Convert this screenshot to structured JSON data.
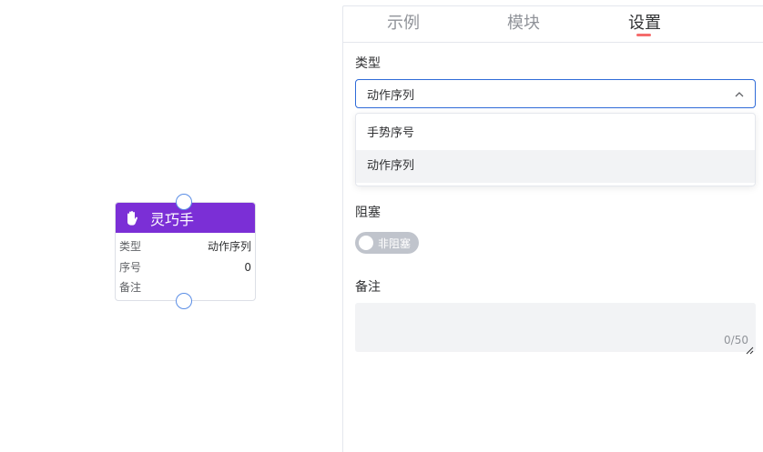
{
  "node": {
    "title": "灵巧手",
    "icon": "hand-icon",
    "rows": [
      {
        "key": "类型",
        "value": "动作序列"
      },
      {
        "key": "序号",
        "value": "0"
      },
      {
        "key": "备注",
        "value": ""
      }
    ]
  },
  "tabs": [
    {
      "label": "示例"
    },
    {
      "label": "模块"
    },
    {
      "label": "设置"
    }
  ],
  "active_tab": "设置",
  "form": {
    "type_label": "类型",
    "type_value": "动作序列",
    "type_options": [
      "手势序号",
      "动作序列"
    ],
    "block_label": "阻塞",
    "block_switch_text": "非阻塞",
    "note_label": "备注",
    "note_counter": "0/50"
  },
  "colors": {
    "node_header": "#7b2fd6",
    "select_border": "#2f6bd8",
    "tab_indicator": "#f56c6c"
  }
}
